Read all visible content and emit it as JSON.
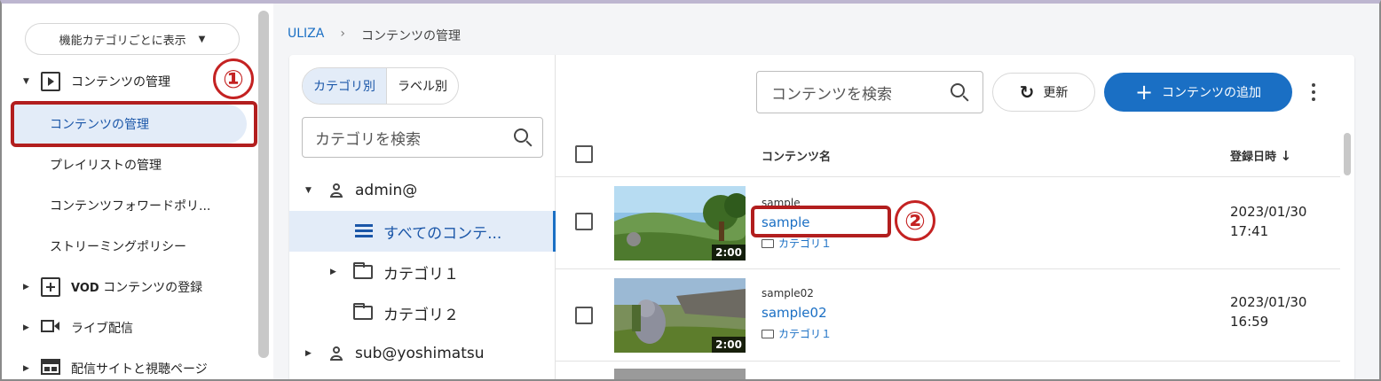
{
  "sidebar": {
    "display_mode": "機能カテゴリごとに表示",
    "groups": [
      {
        "label": "コンテンツの管理",
        "expanded": true
      },
      {
        "label": "VOD コンテンツの登録"
      },
      {
        "label": "ライブ配信"
      },
      {
        "label": "配信サイトと視聴ページ"
      }
    ],
    "items": [
      {
        "label": "コンテンツの管理",
        "active": true
      },
      {
        "label": "プレイリストの管理"
      },
      {
        "label": "コンテンツフォワードポリ..."
      },
      {
        "label": "ストリーミングポリシー"
      }
    ]
  },
  "annotations": {
    "one": "①",
    "two": "②"
  },
  "breadcrumb": {
    "root": "ULIZA",
    "separator": "›",
    "current": "コンテンツの管理"
  },
  "category_panel": {
    "tabs": [
      "カテゴリ別",
      "ラベル別"
    ],
    "search_placeholder": "カテゴリを検索",
    "tree": [
      {
        "label": "admin@",
        "type": "user"
      },
      {
        "label": "すべてのコンテ...",
        "type": "all",
        "selected": true
      },
      {
        "label": "カテゴリ１",
        "type": "folder"
      },
      {
        "label": "カテゴリ２",
        "type": "folder"
      },
      {
        "label": "sub@yoshimatsu",
        "type": "user"
      }
    ]
  },
  "toolbar": {
    "search_placeholder": "コンテンツを検索",
    "refresh_label": "更新",
    "add_label": "コンテンツの追加"
  },
  "table": {
    "col_name": "コンテンツ名",
    "col_date": "登録日時",
    "sort_arrow": "↓",
    "rows": [
      {
        "small": "sample",
        "link": "sample",
        "category": "カテゴリ１",
        "date": "2023/01/30",
        "time": "17:41",
        "duration": "2:00"
      },
      {
        "small": "sample02",
        "link": "sample02",
        "category": "カテゴリ１",
        "date": "2023/01/30",
        "time": "16:59",
        "duration": "2:00"
      }
    ]
  },
  "colors": {
    "accent": "#1a6fc4",
    "annotation_red": "#b21e1e",
    "selected_bg": "#e3ecf8"
  }
}
